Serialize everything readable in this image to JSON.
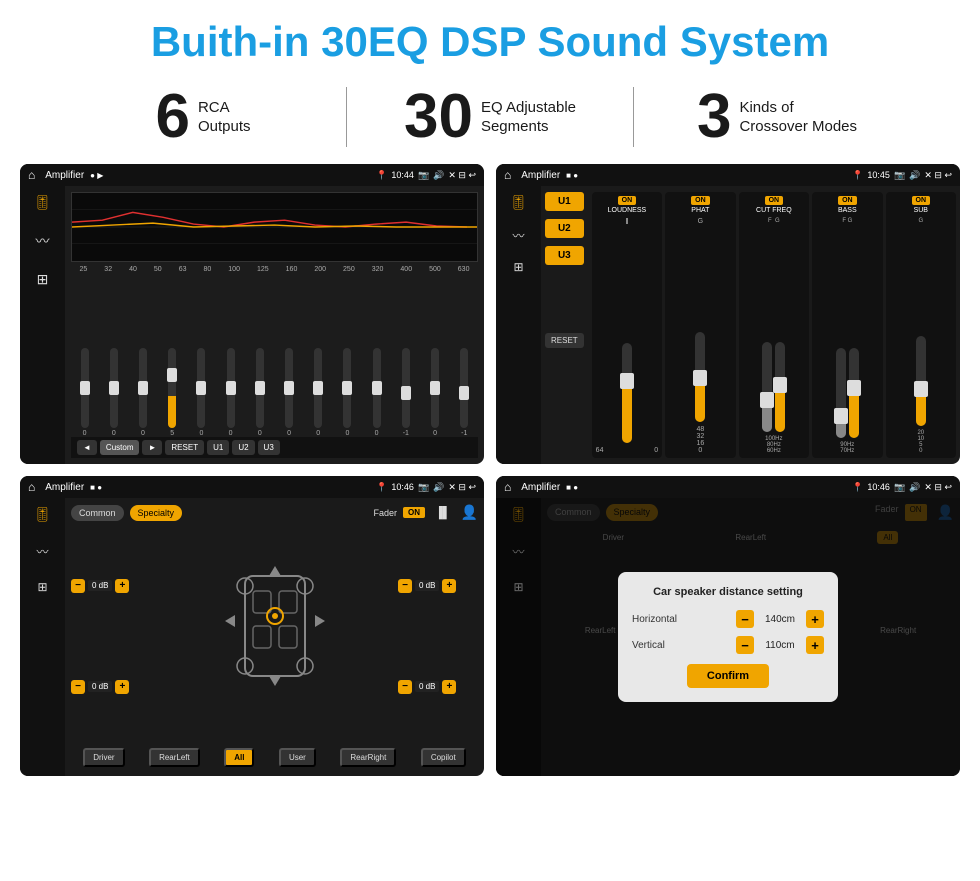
{
  "header": {
    "title": "Buith-in 30EQ DSP Sound System"
  },
  "stats": [
    {
      "number": "6",
      "text": "RCA\nOutputs"
    },
    {
      "number": "30",
      "text": "EQ Adjustable\nSegments"
    },
    {
      "number": "3",
      "text": "Kinds of\nCrossover Modes"
    }
  ],
  "screens": {
    "eq": {
      "title": "Amplifier",
      "time": "10:44",
      "freqs": [
        "25",
        "32",
        "40",
        "50",
        "63",
        "80",
        "100",
        "125",
        "160",
        "200",
        "250",
        "320",
        "400",
        "500",
        "630"
      ],
      "values": [
        "0",
        "0",
        "0",
        "5",
        "0",
        "0",
        "0",
        "0",
        "0",
        "0",
        "0",
        "-1",
        "0",
        "-1"
      ],
      "buttons": [
        "◄",
        "Custom",
        "►",
        "RESET",
        "U1",
        "U2",
        "U3"
      ]
    },
    "crossover": {
      "title": "Amplifier",
      "time": "10:45",
      "u_buttons": [
        "U1",
        "U2",
        "U3"
      ],
      "channels": [
        "LOUDNESS",
        "PHAT",
        "CUT FREQ",
        "BASS",
        "SUB"
      ]
    },
    "fader": {
      "title": "Amplifier",
      "time": "10:46",
      "tabs": [
        "Common",
        "Specialty"
      ],
      "fader_label": "Fader",
      "on_label": "ON",
      "volumes": [
        "0 dB",
        "0 dB",
        "0 dB",
        "0 dB"
      ],
      "bottom_buttons": [
        "Driver",
        "RearLeft",
        "All",
        "User",
        "RearRight",
        "Copilot"
      ]
    },
    "dialog": {
      "title": "Amplifier",
      "time": "10:46",
      "dialog_title": "Car speaker distance setting",
      "horizontal_label": "Horizontal",
      "horizontal_value": "140cm",
      "vertical_label": "Vertical",
      "vertical_value": "110cm",
      "confirm_label": "Confirm"
    }
  }
}
